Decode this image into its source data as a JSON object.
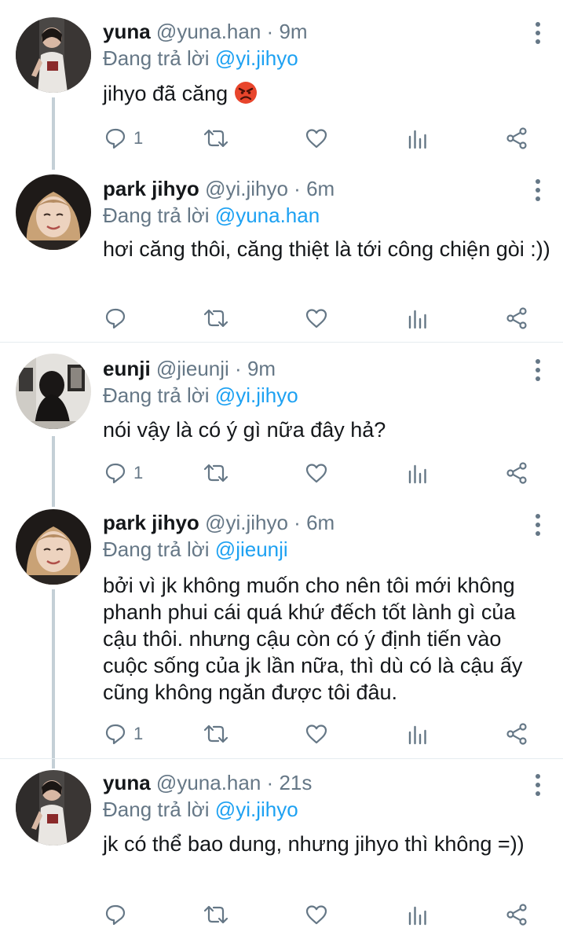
{
  "tweets": [
    {
      "name": "yuna",
      "handle": "@yuna.han",
      "separator": "·",
      "time": "9m",
      "reply_prefix": "Đang trả lời",
      "reply_to": "@yi.jihyo",
      "text": "jihyo đã căng",
      "emoji": "angry-face-emoji",
      "reply_count": "1",
      "avatar": "yuna-avatar"
    },
    {
      "name": "park jihyo",
      "handle": "@yi.jihyo",
      "separator": "·",
      "time": "6m",
      "reply_prefix": "Đang trả lời",
      "reply_to": "@yuna.han",
      "text": "hơi căng thôi, căng thiệt là tới công chiện gòi :))",
      "reply_count": "",
      "avatar": "jihyo-avatar"
    },
    {
      "name": "eunji",
      "handle": "@jieunji",
      "separator": "·",
      "time": "9m",
      "reply_prefix": "Đang trả lời",
      "reply_to": "@yi.jihyo",
      "text": "nói vậy là có ý gì nữa đây hả?",
      "reply_count": "1",
      "avatar": "eunji-avatar"
    },
    {
      "name": "park jihyo",
      "handle": "@yi.jihyo",
      "separator": "·",
      "time": "6m",
      "reply_prefix": "Đang trả lời",
      "reply_to": "@jieunji",
      "text": "bởi vì jk không muốn cho nên tôi mới không phanh phui cái quá khứ đếch tốt lành gì của cậu thôi. nhưng cậu còn có ý định tiến vào cuộc sống của jk lần nữa, thì dù có là cậu ấy cũng không ngăn được tôi đâu.",
      "reply_count": "1",
      "avatar": "jihyo-avatar"
    },
    {
      "name": "yuna",
      "handle": "@yuna.han",
      "separator": "·",
      "time": "21s",
      "reply_prefix": "Đang trả lời",
      "reply_to": "@yi.jihyo",
      "text": "jk có thể bao dung, nhưng jihyo thì không =))",
      "reply_count": "",
      "avatar": "yuna-avatar"
    }
  ],
  "icons": {
    "reply": "reply-icon",
    "retweet": "retweet-icon",
    "like": "like-icon",
    "analytics": "analytics-icon",
    "share": "share-icon",
    "more": "more-vertical-icon"
  },
  "colors": {
    "accent": "#1da1f2",
    "secondary_text": "#657786",
    "primary_text": "#14171a",
    "thread_line": "#c4cfd6",
    "divider": "#e6ecf0"
  }
}
